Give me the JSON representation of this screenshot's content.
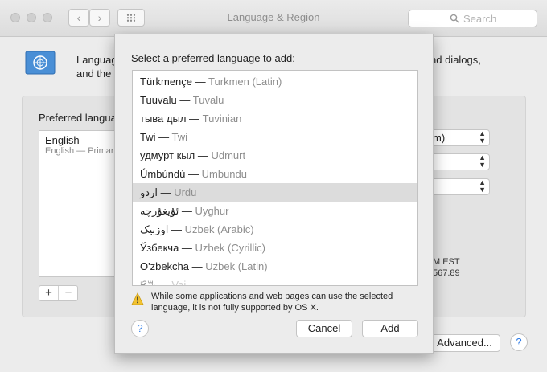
{
  "window": {
    "title": "Language & Region",
    "search_placeholder": "Search",
    "back_glyph": "‹",
    "forward_glyph": "›"
  },
  "background": {
    "intro_line1": "Languag",
    "intro_line1_tail": "nd dialogs,",
    "intro_line2": "and the",
    "preferred_label": "Preferred langua",
    "languages": [
      {
        "name": "English",
        "subtitle": "English — Primar"
      }
    ],
    "plus": "+",
    "minus": "−",
    "popups": [
      "m)",
      "",
      ""
    ],
    "time_fragment": "M EST",
    "number_fragment": "567.89",
    "advanced_button": "Advanced...",
    "help": "?"
  },
  "sheet": {
    "title": "Select a preferred language to add:",
    "languages": [
      {
        "native": "Türkmençe",
        "english": "Turkmen (Latin)"
      },
      {
        "native": "Tuuvalu",
        "english": "Tuvalu"
      },
      {
        "native": "тыва дыл",
        "english": "Tuvinian"
      },
      {
        "native": "Twi",
        "english": "Twi"
      },
      {
        "native": "удмурт кыл",
        "english": "Udmurt"
      },
      {
        "native": "Úmbúndú",
        "english": "Umbundu"
      },
      {
        "native": "اردو",
        "english": "Urdu",
        "selected": true
      },
      {
        "native": "ئۇيغۇرچە",
        "english": "Uyghur"
      },
      {
        "native": "اوزبیک",
        "english": "Uzbek (Arabic)"
      },
      {
        "native": "Ўзбекча",
        "english": "Uzbek (Cyrillic)"
      },
      {
        "native": "O'zbekcha",
        "english": "Uzbek (Latin)"
      },
      {
        "native": "ꕙꔤ",
        "english": "Vai"
      }
    ],
    "dash": "—",
    "warning": "While some applications and web pages can use the selected language, it is not fully supported by OS X.",
    "help": "?",
    "cancel_button": "Cancel",
    "add_button": "Add"
  },
  "colors": {
    "selection": "#dcdcdc",
    "help_accent": "#2a79e6"
  }
}
